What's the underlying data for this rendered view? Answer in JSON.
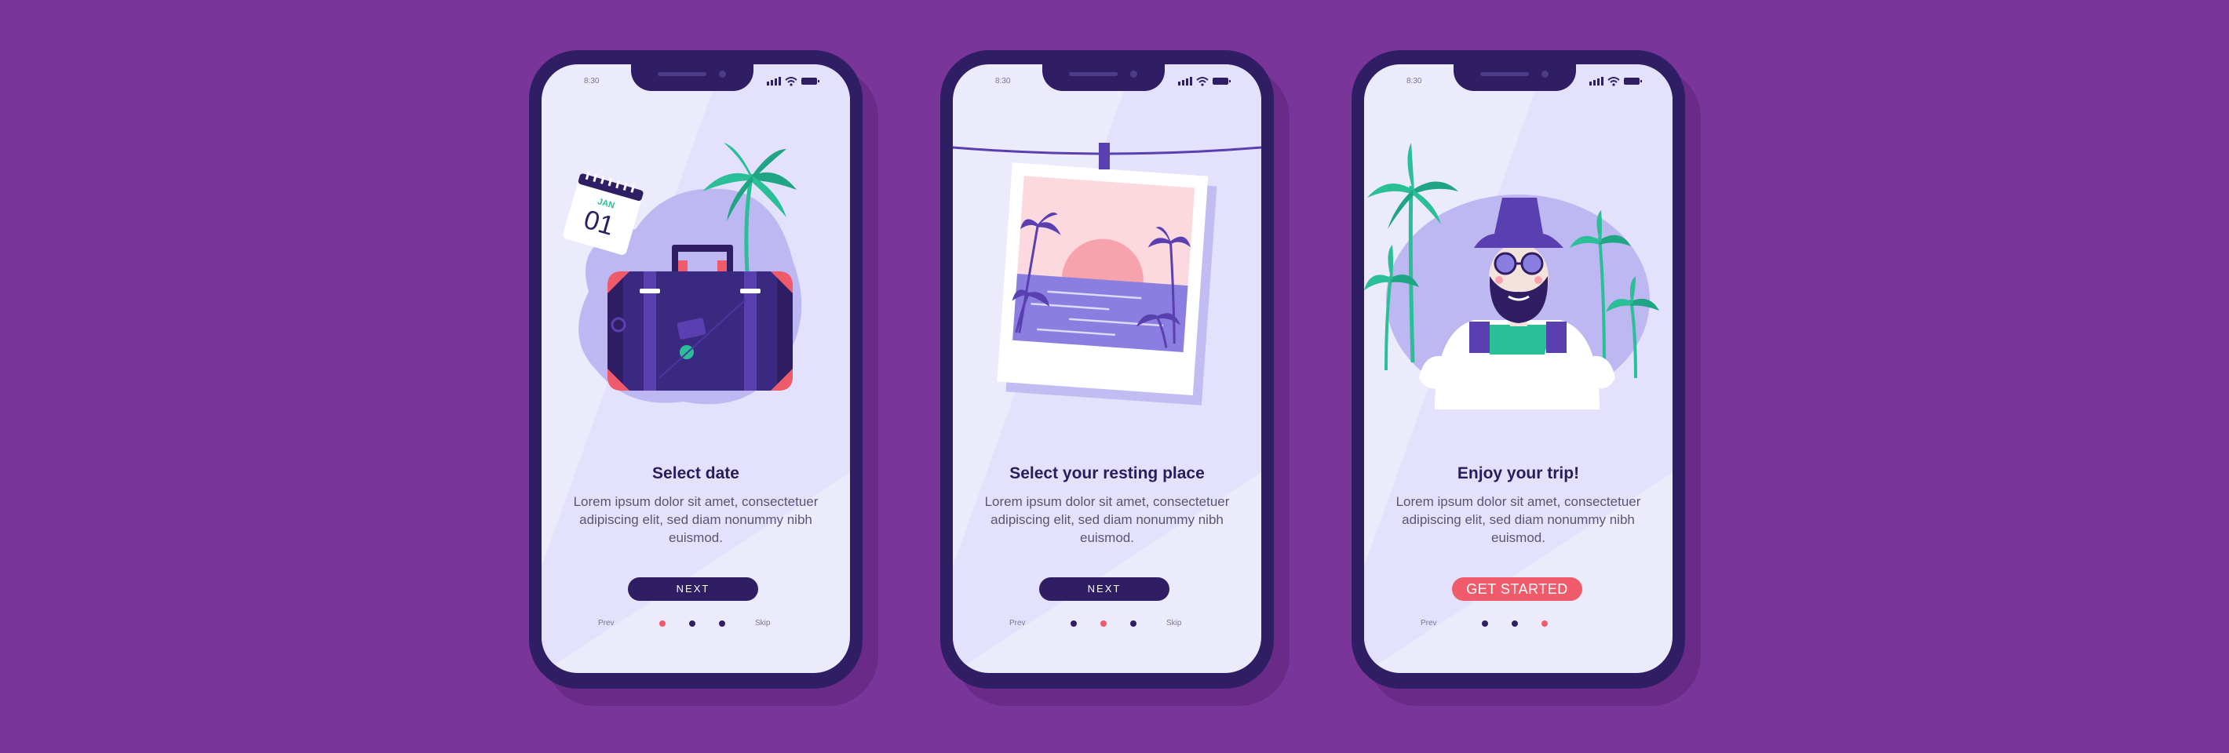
{
  "background_color": "#79359a",
  "colors": {
    "phone_frame": "#2f1e63",
    "screen": "#ecebfc",
    "accent_red": "#ef5b6b",
    "accent_teal": "#2bbf98",
    "accent_purple": "#5a3fb0",
    "blob": "#bdb8f2"
  },
  "screens": [
    {
      "status_time": "8:30",
      "illustration": "suitcase-calendar-palm",
      "calendar_month": "JAN",
      "calendar_day": "01",
      "title": "Select date",
      "body": "Lorem ipsum dolor sit amet, consectetuer adipiscing elit, sed diam nonummy nibh euismod.",
      "button_label": "NEXT",
      "prev_label": "Prev",
      "skip_label": "Skip",
      "active_dot": 1
    },
    {
      "status_time": "8:30",
      "illustration": "hanging-beach-photo",
      "title": "Select your resting place",
      "body": "Lorem ipsum dolor sit amet, consectetuer adipiscing elit, sed diam nonummy nibh euismod.",
      "button_label": "NEXT",
      "prev_label": "Prev",
      "skip_label": "Skip",
      "active_dot": 2
    },
    {
      "status_time": "8:30",
      "illustration": "bearded-traveler-with-hat",
      "title": "Enjoy your trip!",
      "body": "Lorem ipsum dolor sit amet, consectetuer adipiscing elit, sed diam nonummy nibh euismod.",
      "button_label": "GET STARTED",
      "prev_label": "Prev",
      "active_dot": 3
    }
  ]
}
